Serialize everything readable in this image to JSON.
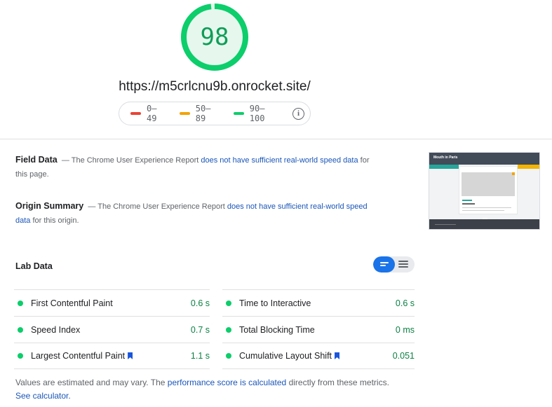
{
  "score": {
    "value": "98",
    "fraction": 0.98,
    "color": "#0cce6b"
  },
  "url": "https://m5crlcnu9b.onrocket.site/",
  "legend": {
    "items": [
      {
        "label": "0–49",
        "color": "#ea4335"
      },
      {
        "label": "50–89",
        "color": "#f4a300"
      },
      {
        "label": "90–100",
        "color": "#0cce6b"
      }
    ],
    "info_icon": "info-icon"
  },
  "field_data": {
    "heading": "Field Data",
    "prefix": "— The Chrome User Experience Report",
    "link": "does not have sufficient real-world speed data",
    "suffix": "for this page."
  },
  "origin_summary": {
    "heading": "Origin Summary",
    "prefix": "— The Chrome User Experience Report",
    "link": "does not have sufficient real-world speed data",
    "suffix": "for this origin."
  },
  "thumbnail": {
    "brand": "Mouth in Paris"
  },
  "lab_data": {
    "title": "Lab Data",
    "metrics": [
      {
        "label": "First Contentful Paint",
        "value": "0.6 s",
        "bookmark": false
      },
      {
        "label": "Time to Interactive",
        "value": "0.6 s",
        "bookmark": false
      },
      {
        "label": "Speed Index",
        "value": "0.7 s",
        "bookmark": false
      },
      {
        "label": "Total Blocking Time",
        "value": "0 ms",
        "bookmark": false
      },
      {
        "label": "Largest Contentful Paint",
        "value": "1.1 s",
        "bookmark": true
      },
      {
        "label": "Cumulative Layout Shift",
        "value": "0.051",
        "bookmark": true
      }
    ]
  },
  "footnote": {
    "text1": "Values are estimated and may vary. The",
    "link1": "performance score is calculated",
    "text2": "directly from these metrics.",
    "link2": "See calculator."
  }
}
